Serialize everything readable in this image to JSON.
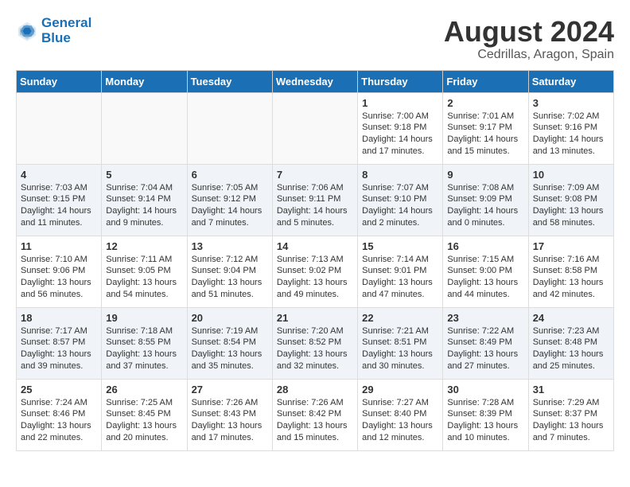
{
  "header": {
    "logo_line1": "General",
    "logo_line2": "Blue",
    "month_title": "August 2024",
    "location": "Cedrillas, Aragon, Spain"
  },
  "days_of_week": [
    "Sunday",
    "Monday",
    "Tuesday",
    "Wednesday",
    "Thursday",
    "Friday",
    "Saturday"
  ],
  "weeks": [
    [
      {
        "day": "",
        "info": ""
      },
      {
        "day": "",
        "info": ""
      },
      {
        "day": "",
        "info": ""
      },
      {
        "day": "",
        "info": ""
      },
      {
        "day": "1",
        "info": "Sunrise: 7:00 AM\nSunset: 9:18 PM\nDaylight: 14 hours\nand 17 minutes."
      },
      {
        "day": "2",
        "info": "Sunrise: 7:01 AM\nSunset: 9:17 PM\nDaylight: 14 hours\nand 15 minutes."
      },
      {
        "day": "3",
        "info": "Sunrise: 7:02 AM\nSunset: 9:16 PM\nDaylight: 14 hours\nand 13 minutes."
      }
    ],
    [
      {
        "day": "4",
        "info": "Sunrise: 7:03 AM\nSunset: 9:15 PM\nDaylight: 14 hours\nand 11 minutes."
      },
      {
        "day": "5",
        "info": "Sunrise: 7:04 AM\nSunset: 9:14 PM\nDaylight: 14 hours\nand 9 minutes."
      },
      {
        "day": "6",
        "info": "Sunrise: 7:05 AM\nSunset: 9:12 PM\nDaylight: 14 hours\nand 7 minutes."
      },
      {
        "day": "7",
        "info": "Sunrise: 7:06 AM\nSunset: 9:11 PM\nDaylight: 14 hours\nand 5 minutes."
      },
      {
        "day": "8",
        "info": "Sunrise: 7:07 AM\nSunset: 9:10 PM\nDaylight: 14 hours\nand 2 minutes."
      },
      {
        "day": "9",
        "info": "Sunrise: 7:08 AM\nSunset: 9:09 PM\nDaylight: 14 hours\nand 0 minutes."
      },
      {
        "day": "10",
        "info": "Sunrise: 7:09 AM\nSunset: 9:08 PM\nDaylight: 13 hours\nand 58 minutes."
      }
    ],
    [
      {
        "day": "11",
        "info": "Sunrise: 7:10 AM\nSunset: 9:06 PM\nDaylight: 13 hours\nand 56 minutes."
      },
      {
        "day": "12",
        "info": "Sunrise: 7:11 AM\nSunset: 9:05 PM\nDaylight: 13 hours\nand 54 minutes."
      },
      {
        "day": "13",
        "info": "Sunrise: 7:12 AM\nSunset: 9:04 PM\nDaylight: 13 hours\nand 51 minutes."
      },
      {
        "day": "14",
        "info": "Sunrise: 7:13 AM\nSunset: 9:02 PM\nDaylight: 13 hours\nand 49 minutes."
      },
      {
        "day": "15",
        "info": "Sunrise: 7:14 AM\nSunset: 9:01 PM\nDaylight: 13 hours\nand 47 minutes."
      },
      {
        "day": "16",
        "info": "Sunrise: 7:15 AM\nSunset: 9:00 PM\nDaylight: 13 hours\nand 44 minutes."
      },
      {
        "day": "17",
        "info": "Sunrise: 7:16 AM\nSunset: 8:58 PM\nDaylight: 13 hours\nand 42 minutes."
      }
    ],
    [
      {
        "day": "18",
        "info": "Sunrise: 7:17 AM\nSunset: 8:57 PM\nDaylight: 13 hours\nand 39 minutes."
      },
      {
        "day": "19",
        "info": "Sunrise: 7:18 AM\nSunset: 8:55 PM\nDaylight: 13 hours\nand 37 minutes."
      },
      {
        "day": "20",
        "info": "Sunrise: 7:19 AM\nSunset: 8:54 PM\nDaylight: 13 hours\nand 35 minutes."
      },
      {
        "day": "21",
        "info": "Sunrise: 7:20 AM\nSunset: 8:52 PM\nDaylight: 13 hours\nand 32 minutes."
      },
      {
        "day": "22",
        "info": "Sunrise: 7:21 AM\nSunset: 8:51 PM\nDaylight: 13 hours\nand 30 minutes."
      },
      {
        "day": "23",
        "info": "Sunrise: 7:22 AM\nSunset: 8:49 PM\nDaylight: 13 hours\nand 27 minutes."
      },
      {
        "day": "24",
        "info": "Sunrise: 7:23 AM\nSunset: 8:48 PM\nDaylight: 13 hours\nand 25 minutes."
      }
    ],
    [
      {
        "day": "25",
        "info": "Sunrise: 7:24 AM\nSunset: 8:46 PM\nDaylight: 13 hours\nand 22 minutes."
      },
      {
        "day": "26",
        "info": "Sunrise: 7:25 AM\nSunset: 8:45 PM\nDaylight: 13 hours\nand 20 minutes."
      },
      {
        "day": "27",
        "info": "Sunrise: 7:26 AM\nSunset: 8:43 PM\nDaylight: 13 hours\nand 17 minutes."
      },
      {
        "day": "28",
        "info": "Sunrise: 7:26 AM\nSunset: 8:42 PM\nDaylight: 13 hours\nand 15 minutes."
      },
      {
        "day": "29",
        "info": "Sunrise: 7:27 AM\nSunset: 8:40 PM\nDaylight: 13 hours\nand 12 minutes."
      },
      {
        "day": "30",
        "info": "Sunrise: 7:28 AM\nSunset: 8:39 PM\nDaylight: 13 hours\nand 10 minutes."
      },
      {
        "day": "31",
        "info": "Sunrise: 7:29 AM\nSunset: 8:37 PM\nDaylight: 13 hours\nand 7 minutes."
      }
    ]
  ]
}
